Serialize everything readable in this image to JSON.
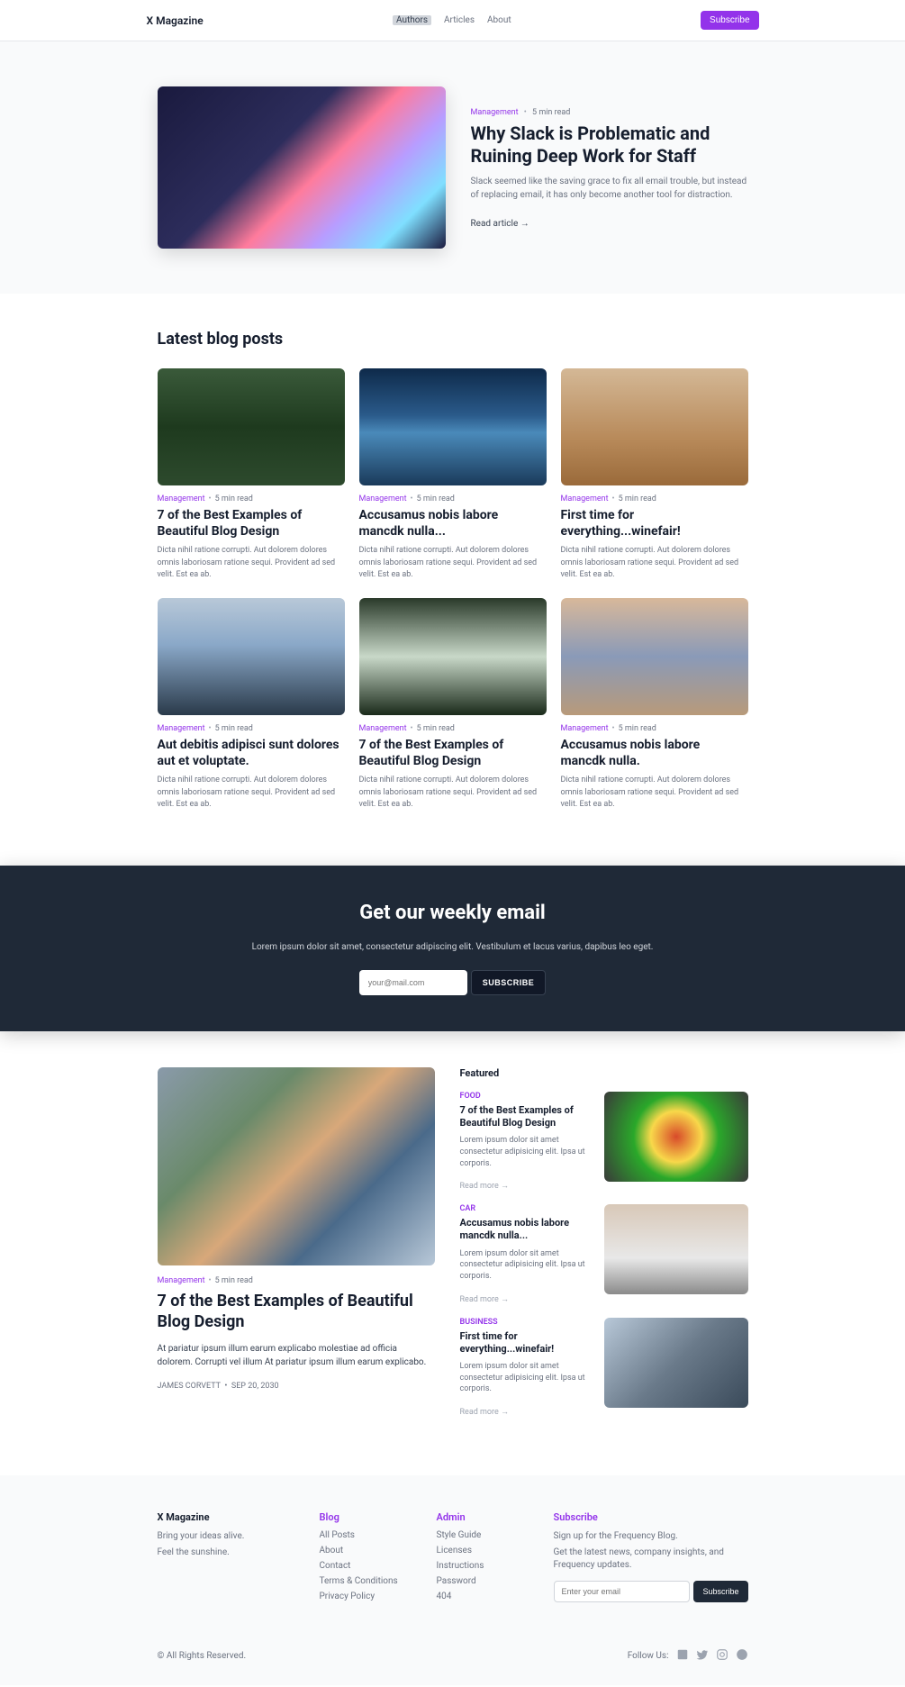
{
  "header": {
    "logo": "X Magazine",
    "nav": [
      "Authors",
      "Articles",
      "About"
    ],
    "subscribe": "Subscribe"
  },
  "hero": {
    "category": "Management",
    "readtime": "5 min read",
    "title": "Why Slack is Problematic and Ruining Deep Work for Staff",
    "desc": "Slack seemed like the saving grace to fix all email trouble, but instead of replacing email, it has only become another tool for distraction.",
    "link": "Read article →"
  },
  "latest": {
    "heading": "Latest blog posts",
    "posts": [
      {
        "category": "Management",
        "readtime": "5 min read",
        "title": "7 of the Best Examples of Beautiful Blog Design",
        "desc": "Dicta nihil ratione corrupti. Aut dolorem dolores omnis laboriosam ratione sequi. Provident ad sed velit. Est ea ab."
      },
      {
        "category": "Management",
        "readtime": "5 min read",
        "title": "Accusamus nobis labore mancdk nulla...",
        "desc": "Dicta nihil ratione corrupti. Aut dolorem dolores omnis laboriosam ratione sequi. Provident ad sed velit. Est ea ab."
      },
      {
        "category": "Management",
        "readtime": "5 min read",
        "title": "First time for everything...winefair!",
        "desc": "Dicta nihil ratione corrupti. Aut dolorem dolores omnis laboriosam ratione sequi. Provident ad sed velit. Est ea ab."
      },
      {
        "category": "Management",
        "readtime": "5 min read",
        "title": "Aut debitis adipisci sunt dolores aut et voluptate.",
        "desc": "Dicta nihil ratione corrupti. Aut dolorem dolores omnis laboriosam ratione sequi. Provident ad sed velit. Est ea ab."
      },
      {
        "category": "Management",
        "readtime": "5 min read",
        "title": "7 of the Best Examples of Beautiful Blog Design",
        "desc": "Dicta nihil ratione corrupti. Aut dolorem dolores omnis laboriosam ratione sequi. Provident ad sed velit. Est ea ab."
      },
      {
        "category": "Management",
        "readtime": "5 min read",
        "title": "Accusamus nobis labore mancdk nulla.",
        "desc": "Dicta nihil ratione corrupti. Aut dolorem dolores omnis laboriosam ratione sequi. Provident ad sed velit. Est ea ab."
      }
    ]
  },
  "newsletter": {
    "title": "Get our weekly email",
    "desc": "Lorem ipsum dolor sit amet, consectetur adipiscing elit. Vestibulum et lacus varius, dapibus leo eget.",
    "placeholder": "your@mail.com",
    "button": "SUBSCRIBE"
  },
  "featured": {
    "left": {
      "category": "Management",
      "readtime": "5 min read",
      "title": "7 of the Best Examples of Beautiful Blog Design",
      "desc": "At pariatur ipsum illum earum explicabo molestiae ad officia dolorem. Corrupti vel illum At pariatur ipsum illum earum explicabo.",
      "author": "JAMES CORVETT",
      "date": "SEP 20, 2030"
    },
    "right": {
      "heading": "Featured",
      "items": [
        {
          "cat": "FOOD",
          "title": "7 of the Best Examples of Beautiful Blog Design",
          "desc": "Lorem ipsum dolor sit amet consectetur adipisicing elit. Ipsa ut corporis.",
          "read": "Read more →"
        },
        {
          "cat": "CAR",
          "title": "Accusamus nobis labore mancdk nulla...",
          "desc": "Lorem ipsum dolor sit amet consectetur adipisicing elit. Ipsa ut corporis.",
          "read": "Read more →"
        },
        {
          "cat": "BUSINESS",
          "title": "First time for everything...winefair!",
          "desc": "Lorem ipsum dolor sit amet consectetur adipisicing elit. Ipsa ut corporis.",
          "read": "Read more →"
        }
      ]
    }
  },
  "footer": {
    "brand": {
      "name": "X Magazine",
      "line1": "Bring your ideas alive.",
      "line2": "Feel the sunshine."
    },
    "blog": {
      "heading": "Blog",
      "items": [
        "All Posts",
        "About",
        "Contact",
        "Terms & Conditions",
        "Privacy Policy"
      ]
    },
    "admin": {
      "heading": "Admin",
      "items": [
        "Style Guide",
        "Licenses",
        "Instructions",
        "Password",
        "404"
      ]
    },
    "subscribe": {
      "heading": "Subscribe",
      "line1": "Sign up for the Frequency Blog.",
      "line2": "Get the latest news, company insights, and Frequency updates.",
      "placeholder": "Enter your email",
      "button": "Subscribe"
    },
    "copyright": "© All Rights Reserved.",
    "follow": "Follow Us:"
  }
}
